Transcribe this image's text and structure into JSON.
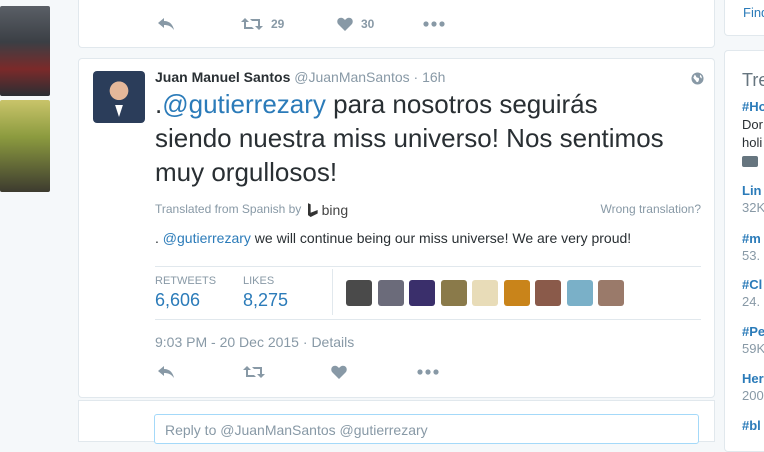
{
  "previous_tweet": {
    "retweet_count": "29",
    "like_count": "30"
  },
  "tweet": {
    "fullname": "Juan Manuel Santos",
    "handle": "@JuanManSantos",
    "separator": "·",
    "time": "16h",
    "text_prefix": ".",
    "text_mention": "@gutierrezary",
    "text_body": " para nosotros seguirás siendo nuestra miss universo! Nos sentimos muy orgullosos!",
    "translated_from": "Translated from Spanish by",
    "translator": "bing",
    "wrong_translation": "Wrong translation?",
    "translation_prefix": ". ",
    "translation_mention": "@gutierrezary",
    "translation_body": " we will continue being our miss universe! We are very proud!",
    "retweets_label": "RETWEETS",
    "retweets_value": "6,606",
    "likes_label": "LIKES",
    "likes_value": "8,275",
    "timestamp": "9:03 PM - 20 Dec 2015",
    "timestamp_sep": " · ",
    "details": "Details",
    "liker_avatar_colors": [
      "#4a4a4a",
      "#6b6b7a",
      "#3a2f6b",
      "#8a7a4a",
      "#e8dcb8",
      "#c9841a",
      "#8a5a4a",
      "#7ab0c8",
      "#9a7a6a"
    ]
  },
  "reply": {
    "placeholder": "Reply to @JuanManSantos @gutierrezary"
  },
  "sidebar": {
    "find_label": "Find",
    "trends_title": "Tre",
    "trends": [
      {
        "name": "#Ho",
        "meta": "",
        "desc1": "Dor",
        "desc2": "holi",
        "has_icon": true
      },
      {
        "name": "Lin",
        "meta": "32K"
      },
      {
        "name": "#m",
        "meta": "53."
      },
      {
        "name": "#Cl",
        "meta": "24."
      },
      {
        "name": "#Pe",
        "meta": "59K"
      },
      {
        "name": "Her",
        "meta": "200"
      },
      {
        "name": "#bl",
        "meta": ""
      }
    ]
  },
  "colors": {
    "link": "#2b7bb9",
    "muted": "#8899a6",
    "text": "#292f33"
  }
}
